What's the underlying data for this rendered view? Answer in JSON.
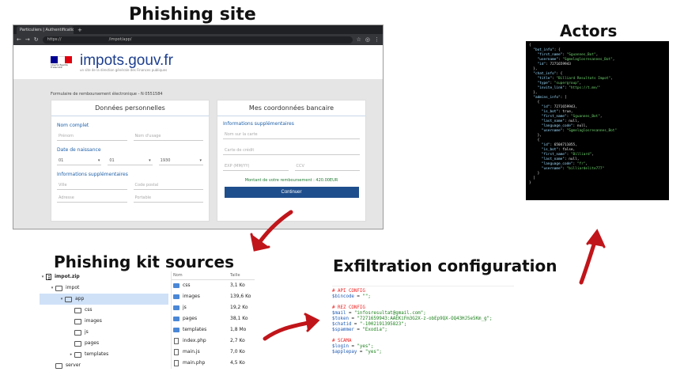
{
  "headings": {
    "phishing_site": "Phishing site",
    "actors": "Actors",
    "kit": "Phishing kit sources",
    "exfil": "Exfiltration configuration"
  },
  "browser": {
    "tab_title": "Particuliers | Authentification",
    "new_tab": "+",
    "url_prefix": "https://",
    "url_path": "/impot/app/",
    "brand": "impots.gouv.fr",
    "brand_sub": "un site de la direction générale des Finances publiques",
    "flag_text": "Liberté Égalité Fraternité",
    "form_title": "Formulaire de remboursement électronique - N 0551584",
    "left_card": {
      "title": "Données personnelles",
      "section_name": "Nom complet",
      "prenom_ph": "Prénom",
      "nom_usage_ph": "Nom d'usage",
      "section_birth": "Date de naissance",
      "day": "01",
      "month": "01",
      "year": "1930",
      "section_extra": "Informations supplémentaires",
      "ville_ph": "Ville",
      "cp_ph": "Code postal",
      "adresse_ph": "Adresse",
      "portable_ph": "Portable"
    },
    "right_card": {
      "title": "Mes coordonnées bancaire",
      "section_extra": "Informations supplémentaires",
      "nom_carte_ph": "Nom sur la carte",
      "carte_ph": "Carte de crédit",
      "exp_ph": "EXP (MM/YY)",
      "ccv_ph": "CCV",
      "montant": "Montant de votre remboursement : 420.00EUR",
      "button": "Continuer"
    }
  },
  "actors_json": {
    "bot_info_key": "\"bot_info\": {",
    "bot_first_name": "\"Sguannes_Bot\"",
    "bot_username": "\"Sgmelaglosresannes_Bot\"",
    "bot_id": "7271659943",
    "chat_title": "\"Billiard Resultats Impot\"",
    "chat_type": "\"supergroup\"",
    "chat_invite": "\"https://t.me/\"",
    "admin1_id": "7271659943",
    "admin1_is_bot": "true",
    "admin1_first": "\"Sguannes_Bot\"",
    "admin1_last": "null",
    "admin1_lang": "null",
    "admin1_user": "\"Sgmelaglosresannes_Bot\"",
    "admin2_id": "6504711055",
    "admin2_is_bot": "false",
    "admin2_first": "\"Billiard\"",
    "admin2_last": "null",
    "admin2_lang": "\"fr\"",
    "admin2_user": "\"billiardelite777\""
  },
  "kit": {
    "tree": [
      {
        "label": "impot.zip",
        "twisty": "▾",
        "icon": "zip-icon",
        "indent": 0,
        "bold": true
      },
      {
        "label": "impot",
        "twisty": "▾",
        "icon": "folder-icon",
        "indent": 1
      },
      {
        "label": "app",
        "twisty": "▾",
        "icon": "folder-icon",
        "indent": 2,
        "selected": true
      },
      {
        "label": "css",
        "twisty": "",
        "icon": "folder-icon",
        "indent": 3
      },
      {
        "label": "images",
        "twisty": "",
        "icon": "folder-icon",
        "indent": 3
      },
      {
        "label": "js",
        "twisty": "",
        "icon": "folder-icon",
        "indent": 3
      },
      {
        "label": "pages",
        "twisty": "",
        "icon": "folder-icon",
        "indent": 3
      },
      {
        "label": "templates",
        "twisty": "▸",
        "icon": "folder-icon",
        "indent": 3
      },
      {
        "label": "server",
        "twisty": "",
        "icon": "folder-icon",
        "indent": 1
      }
    ],
    "col_name": "Nom",
    "col_size": "Taille",
    "files": [
      {
        "name": "css",
        "size": "3,1 Ko",
        "type": "folder"
      },
      {
        "name": "images",
        "size": "139,6 Ko",
        "type": "folder"
      },
      {
        "name": "js",
        "size": "19,2 Ko",
        "type": "folder"
      },
      {
        "name": "pages",
        "size": "38,1 Ko",
        "type": "folder"
      },
      {
        "name": "templates",
        "size": "1,8 Mo",
        "type": "folder"
      },
      {
        "name": "index.php",
        "size": "2,7 Ko",
        "type": "file"
      },
      {
        "name": "main.js",
        "size": "7,0 Ko",
        "type": "file"
      },
      {
        "name": "main.php",
        "size": "4,5 Ko",
        "type": "file"
      }
    ]
  },
  "config": {
    "c1": "# API CONFIG",
    "l1v": "$bincode",
    "l1s": "\"\";",
    "c2": "# REZ CONFIG",
    "l2v": "$mail",
    "l2s": "\"infosresultat@gmail.com\";",
    "l3v": "$token",
    "l3s": "\"7271659943:AAEKiFm3G2X-z-obEp9QX-OQ43HJ5e5Km_g\";",
    "l4v": "$chatid",
    "l4s": "\"-1002191395823\";",
    "l5v": "$spammer",
    "l5s": "\"Exodia\";",
    "c3": "# SCAMA",
    "l6v": "$login",
    "l6s": "\"yes\";",
    "l7v": "$applepay",
    "l7s": "\"yes\";"
  },
  "colors": {
    "arrow": "#c0151a",
    "gov_blue": "#1d3f8f",
    "button_blue": "#1f4e8c"
  }
}
